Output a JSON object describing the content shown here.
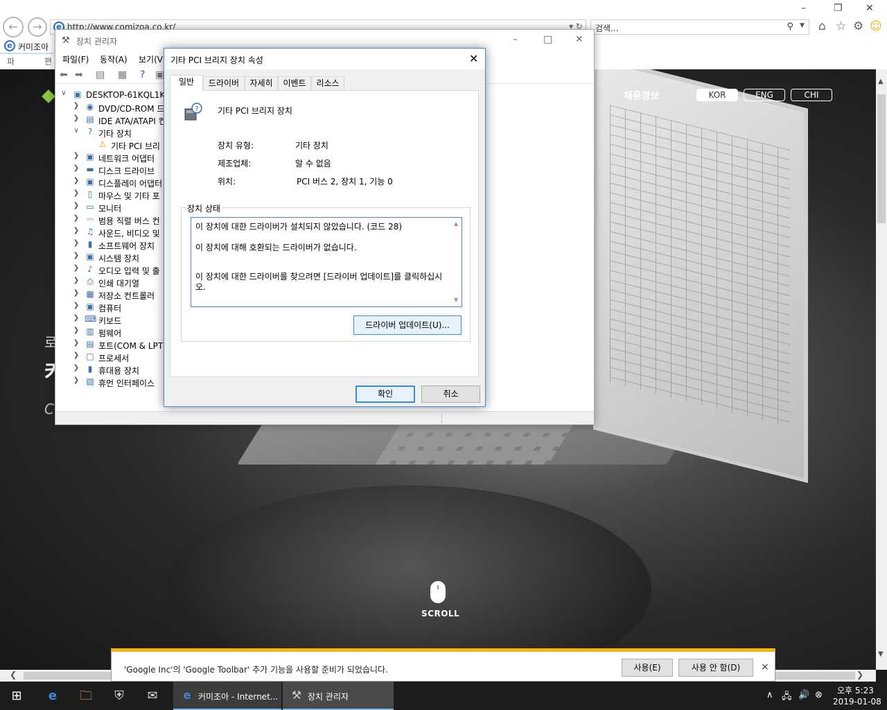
{
  "browser": {
    "url": "http://www.comizoa.co.kr/",
    "search_placeholder": "검색...",
    "tab_title": "커미조아",
    "menu": [
      "파일(F)",
      "편"
    ]
  },
  "website": {
    "nav_recruit": "채용정보",
    "lang": [
      "KOR",
      "ENG",
      "CHI"
    ],
    "hero_1": "로",
    "hero_2": "커",
    "hero_3": "Co",
    "scroll_label": "SCROLL"
  },
  "notification": {
    "text": "'Google Inc'의 'Google Toolbar' 추가 기능을 사용할 준비가 되었습니다.",
    "enable_label": "사용(E)",
    "disable_label": "사용 안 함(D)",
    "close_label": "×"
  },
  "device_manager": {
    "title": "장치 관리자",
    "menu": [
      "파일(F)",
      "동작(A)",
      "보기(V"
    ],
    "root": "DESKTOP-61KQL1K",
    "items": [
      {
        "label": "DVD/CD-ROM 드",
        "icon": "dvd-icon",
        "expanded": false
      },
      {
        "label": "IDE ATA/ATAPI 컨",
        "icon": "ide-icon",
        "expanded": false
      },
      {
        "label": "기타 장치",
        "icon": "unknown-device-icon",
        "expanded": true
      },
      {
        "label": "기타 PCI 브리",
        "icon": "warning-device-icon",
        "child": true
      },
      {
        "label": "네트워크 어댑터",
        "icon": "network-icon",
        "expanded": false
      },
      {
        "label": "디스크 드라이브",
        "icon": "disk-icon",
        "expanded": false
      },
      {
        "label": "디스플레이 어댑터",
        "icon": "display-icon",
        "expanded": false
      },
      {
        "label": "마우스 및 기타 포",
        "icon": "mouse-icon",
        "expanded": false
      },
      {
        "label": "모니터",
        "icon": "monitor-icon",
        "expanded": false
      },
      {
        "label": "범용 직렬 버스 컨",
        "icon": "usb-icon",
        "expanded": false
      },
      {
        "label": "사운드, 비디오 및",
        "icon": "sound-icon",
        "expanded": false
      },
      {
        "label": "소프트웨어 장치",
        "icon": "software-icon",
        "expanded": false
      },
      {
        "label": "시스템 장치",
        "icon": "system-icon",
        "expanded": false
      },
      {
        "label": "오디오 입력 및 출",
        "icon": "audio-icon",
        "expanded": false
      },
      {
        "label": "인쇄 대기열",
        "icon": "printer-icon",
        "expanded": false
      },
      {
        "label": "저장소 컨트롤러",
        "icon": "storage-icon",
        "expanded": false
      },
      {
        "label": "컴퓨터",
        "icon": "computer-icon",
        "expanded": false
      },
      {
        "label": "키보드",
        "icon": "keyboard-icon",
        "expanded": false
      },
      {
        "label": "펌웨어",
        "icon": "firmware-icon",
        "expanded": false
      },
      {
        "label": "포트(COM & LPT",
        "icon": "port-icon",
        "expanded": false
      },
      {
        "label": "프로세서",
        "icon": "processor-icon",
        "expanded": false
      },
      {
        "label": "휴대용 장치",
        "icon": "portable-icon",
        "expanded": false
      },
      {
        "label": "휴먼 인터페이스",
        "icon": "hid-icon",
        "expanded": false
      }
    ]
  },
  "properties": {
    "title": "기타 PCI 브리지 장치 속성",
    "tabs": [
      "일반",
      "드라이버",
      "자세히",
      "이벤트",
      "리소스"
    ],
    "device_name": "기타 PCI 브리지 장치",
    "type_label": "장치 유형:",
    "type_value": "기타 장치",
    "maker_label": "제조업체:",
    "maker_value": "알 수 없음",
    "location_label": "위치:",
    "location_value": "PCI 버스 2, 장치 1, 기능 0",
    "status_group": "장치 상태",
    "status_line1": "이 장치에 대한 드라이버가 설치되지 않았습니다. (코드 28)",
    "status_line2": "이 장치에 대해 호환되는 드라이버가 없습니다.",
    "status_line3": "이 장치에 대한 드라이버를 찾으려면 [드라이버 업데이트]를 클릭하십시오.",
    "update_button": "드라이버 업데이트(U)...",
    "ok": "확인",
    "cancel": "취소"
  },
  "taskbar": {
    "ie_task": "커미조아 - Internet...",
    "dm_task": "장치 관리자",
    "time": "오후 5:23",
    "date": "2019-01-08"
  },
  "colors": {
    "accent": "#3c8ad8",
    "notification_stripe": "#f4b400",
    "logo_green": "#8dc63f"
  }
}
